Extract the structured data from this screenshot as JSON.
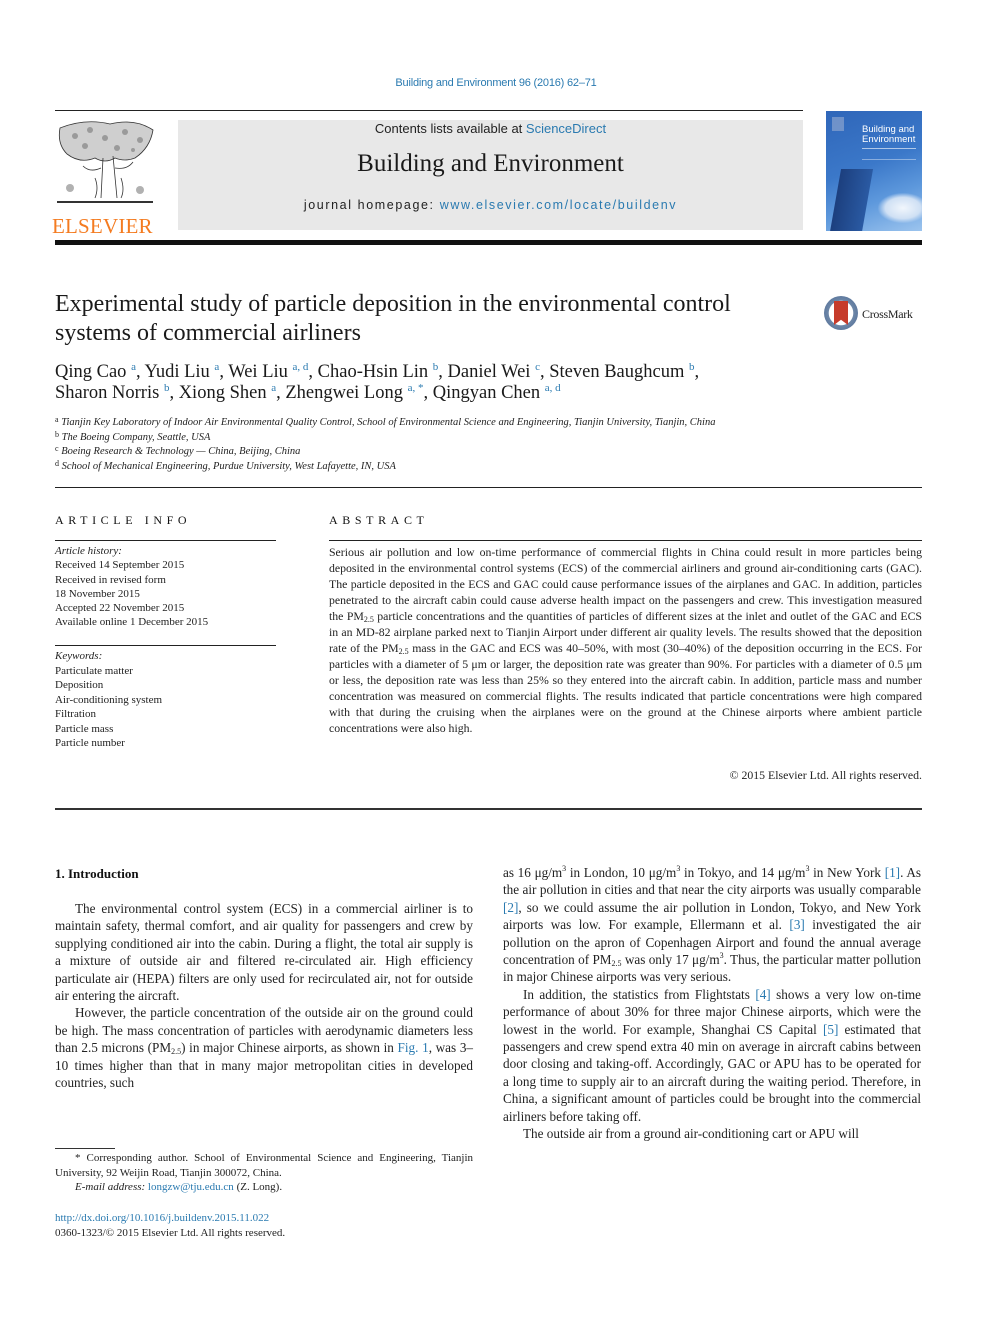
{
  "header": {
    "journal_ref": "Building and Environment 96 (2016) 62–71",
    "contents_prefix": "Contents lists available at ",
    "contents_link": "ScienceDirect",
    "journal_title": "Building and Environment",
    "homepage_prefix": "journal homepage: ",
    "homepage_link": "www.elsevier.com/locate/buildenv",
    "publisher_logo": "ELSEVIER",
    "cover_title_line1": "Building and",
    "cover_title_line2": "Environment",
    "crossmark_label": "CrossMark"
  },
  "article": {
    "title": "Experimental study of particle deposition in the environmental control systems of commercial airliners",
    "authors": [
      {
        "name": "Qing Cao",
        "aff": "a"
      },
      {
        "name": "Yudi Liu",
        "aff": "a"
      },
      {
        "name": "Wei Liu",
        "aff": "a, d"
      },
      {
        "name": "Chao-Hsin Lin",
        "aff": "b"
      },
      {
        "name": "Daniel Wei",
        "aff": "c"
      },
      {
        "name": "Steven Baughcum",
        "aff": "b"
      },
      {
        "name": "Sharon Norris",
        "aff": "b"
      },
      {
        "name": "Xiong Shen",
        "aff": "a"
      },
      {
        "name": "Zhengwei Long",
        "aff": "a, *"
      },
      {
        "name": "Qingyan Chen",
        "aff": "a, d"
      }
    ],
    "affiliations": [
      {
        "mark": "a",
        "text": "Tianjin Key Laboratory of Indoor Air Environmental Quality Control, School of Environmental Science and Engineering, Tianjin University, Tianjin, China"
      },
      {
        "mark": "b",
        "text": "The Boeing Company, Seattle, USA"
      },
      {
        "mark": "c",
        "text": "Boeing Research & Technology — China, Beijing, China"
      },
      {
        "mark": "d",
        "text": "School of Mechanical Engineering, Purdue University, West Lafayette, IN, USA"
      }
    ]
  },
  "article_info": {
    "heading": "ARTICLE INFO",
    "history_label": "Article history:",
    "history": [
      "Received 14 September 2015",
      "Received in revised form",
      "18 November 2015",
      "Accepted 22 November 2015",
      "Available online 1 December 2015"
    ],
    "keywords_label": "Keywords:",
    "keywords": [
      "Particulate matter",
      "Deposition",
      "Air-conditioning system",
      "Filtration",
      "Particle mass",
      "Particle number"
    ]
  },
  "abstract": {
    "heading": "ABSTRACT",
    "p1": "Serious air pollution and low on-time performance of commercial flights in China could result in more particles being deposited in the environmental control systems (ECS) of the commercial airliners and ground air-conditioning carts (GAC). The particle deposited in the ECS and GAC could cause performance issues of the airplanes and GAC. In addition, particles penetrated to the aircraft cabin could cause adverse health impact on the passengers and crew. This investigation measured the PM",
    "sub1": "2.5",
    "p2": " particle concentrations and the quantities of particles of different sizes at the inlet and outlet of the GAC and ECS in an MD-82 airplane parked next to Tianjin Airport under different air quality levels. The results showed that the deposition rate of the PM",
    "sub2": "2.5",
    "p3": " mass in the GAC and ECS was 40–50%, with most (30–40%) of the deposition occurring in the ECS. For particles with a diameter of 5 μm or larger, the deposition rate was greater than 90%. For particles with a diameter of 0.5 μm or less, the deposition rate was less than 25% so they entered into the aircraft cabin. In addition, particle mass and number concentration was measured on commercial flights. The results indicated that particle concentrations were high compared with that during the cruising when the airplanes were on the ground at the Chinese airports where ambient particle concentrations were also high.",
    "copyright": "© 2015 Elsevier Ltd. All rights reserved."
  },
  "body": {
    "section_title": "1.  Introduction",
    "left_p1": "The environmental control system (ECS) in a commercial airliner is to maintain safety, thermal comfort, and air quality for passengers and crew by supplying conditioned air into the cabin. During a flight, the total air supply is a mixture of outside air and filtered re-circulated air. High efficiency particulate air (HEPA) filters are only used for recirculated air, not for outside air entering the aircraft.",
    "left_p2_a": "However, the particle concentration of the outside air on the ground could be high. The mass concentration of particles with aerodynamic diameters less than 2.5 microns (PM",
    "left_p2_sub": "2.5",
    "left_p2_b": ") in major Chinese airports, as shown in ",
    "left_p2_link": "Fig. 1",
    "left_p2_c": ", was 3–10 times higher than that in many major metropolitan cities in developed countries, such",
    "right_p1_a": "as 16 μg/m",
    "right_p1_b": " in London, 10 μg/m",
    "right_p1_c": " in Tokyo, and 14 μg/m",
    "right_p1_d": " in New York ",
    "right_p1_ref1": "[1]",
    "right_p1_e": ". As the air pollution in cities and that near the city airports was usually comparable ",
    "right_p1_ref2": "[2]",
    "right_p1_f": ", so we could assume the air pollution in London, Tokyo, and New York airports was low. For example, Ellermann et al. ",
    "right_p1_ref3": "[3]",
    "right_p1_g": " investigated the air pollution on the apron of Copenhagen Airport and found the annual average concentration of PM",
    "right_p1_sub": "2.5",
    "right_p1_h": " was only 17 μg/m",
    "right_p1_i": ". Thus, the particular matter pollution in major Chinese airports was very serious.",
    "sup3": "3",
    "right_p2_a": "In addition, the statistics from Flightstats ",
    "right_p2_ref4": "[4]",
    "right_p2_b": " shows a very low on-time performance of about 30% for three major Chinese airports, which were the lowest in the world. For example, Shanghai CS Capital ",
    "right_p2_ref5": "[5]",
    "right_p2_c": " estimated that passengers and crew spend extra 40 min on average in aircraft cabins between door closing and taking-off. Accordingly, GAC or APU has to be operated for a long time to supply air to an aircraft during the waiting period. Therefore, in China, a significant amount of particles could be brought into the commercial airliners before taking off.",
    "right_p3": "The outside air from a ground air-conditioning cart or APU will"
  },
  "footnote": {
    "corresponding": "* Corresponding author. School of Environmental Science and Engineering, Tianjin University, 92 Weijin Road, Tianjin 300072, China.",
    "email_label": "E-mail address: ",
    "email": "longzw@tju.edu.cn",
    "email_suffix": " (Z. Long).",
    "doi": "http://dx.doi.org/10.1016/j.buildenv.2015.11.022",
    "issn": "0360-1323/© 2015 Elsevier Ltd. All rights reserved."
  }
}
